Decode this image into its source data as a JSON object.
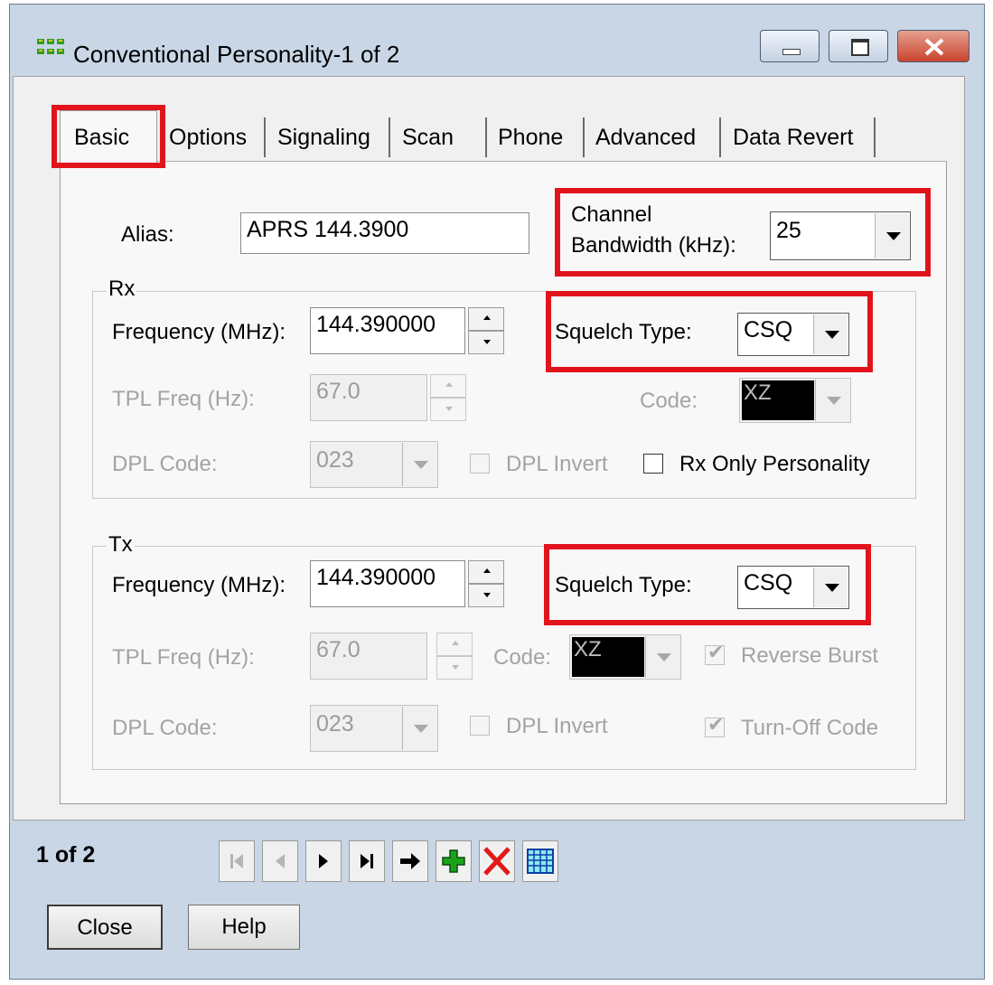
{
  "window": {
    "title": "Conventional Personality-1 of 2",
    "accent_color": "#e1141c"
  },
  "tabs": [
    "Basic",
    "Options",
    "Signaling",
    "Scan",
    "Phone",
    "Advanced",
    "Data Revert"
  ],
  "basic": {
    "alias_label": "Alias:",
    "alias_value": "APRS 144.3900",
    "bandwidth_label_1": "Channel",
    "bandwidth_label_2": "Bandwidth (kHz):",
    "bandwidth_value": "25"
  },
  "rx": {
    "group_title": "Rx",
    "freq_label": "Frequency (MHz):",
    "freq_value": "144.390000",
    "squelch_label": "Squelch Type:",
    "squelch_value": "CSQ",
    "tpl_label": "TPL Freq (Hz):",
    "tpl_value": "67.0",
    "code_label": "Code:",
    "code_value": "XZ",
    "dpl_label": "DPL Code:",
    "dpl_value": "023",
    "dpl_invert_label": "DPL Invert",
    "rx_only_label": "Rx Only Personality"
  },
  "tx": {
    "group_title": "Tx",
    "freq_label": "Frequency (MHz):",
    "freq_value": "144.390000",
    "squelch_label": "Squelch Type:",
    "squelch_value": "CSQ",
    "tpl_label": "TPL Freq (Hz):",
    "tpl_value": "67.0",
    "code_label": "Code:",
    "code_value": "XZ",
    "reverse_burst_label": "Reverse Burst",
    "dpl_label": "DPL Code:",
    "dpl_value": "023",
    "dpl_invert_label": "DPL Invert",
    "turn_off_label": "Turn-Off Code"
  },
  "navigator": {
    "record_text": "1 of 2"
  },
  "buttons": {
    "close": "Close",
    "help": "Help"
  }
}
